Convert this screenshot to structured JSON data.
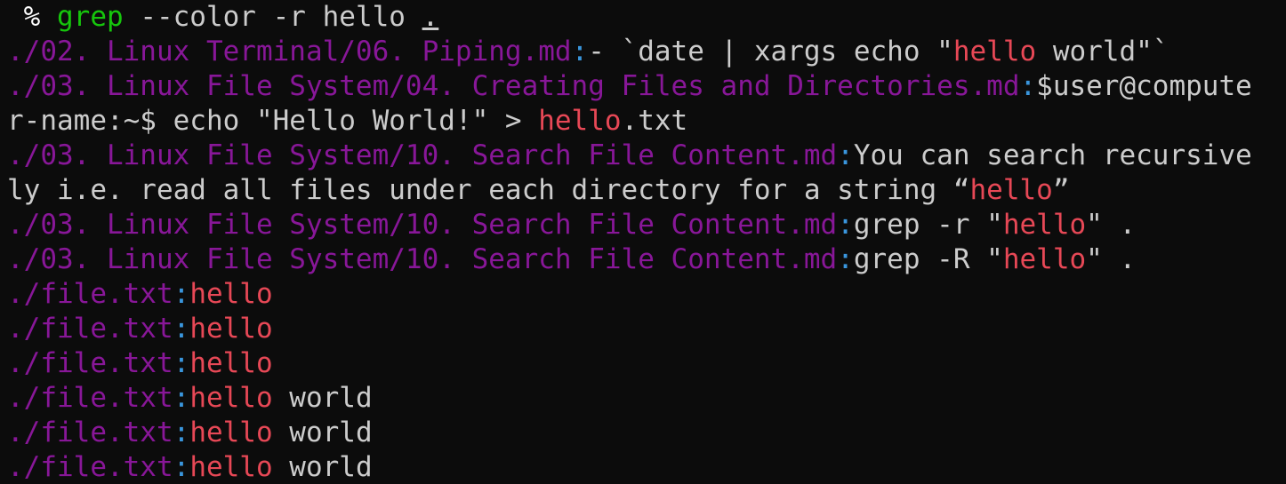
{
  "colors": {
    "background": "#0c0c0c",
    "default_text": "#cccccc",
    "prompt": "#ffffff",
    "command": "#16c60c",
    "file_path": "#881798",
    "separator": "#3a96dd",
    "match": "#e74856"
  },
  "lines": [
    {
      "type": "prompt",
      "segments": [
        {
          "text": " % ",
          "role": "prompt"
        },
        {
          "text": "grep",
          "role": "command"
        },
        {
          "text": " --color -r hello ",
          "role": "default"
        },
        {
          "text": ".",
          "role": "default",
          "underline": true
        }
      ]
    },
    {
      "type": "output",
      "segments": [
        {
          "text": "./02. Linux Terminal/06. Piping.md",
          "role": "file_path"
        },
        {
          "text": ":",
          "role": "separator"
        },
        {
          "text": "- `date | xargs echo \"",
          "role": "default"
        },
        {
          "text": "hello",
          "role": "match"
        },
        {
          "text": " world\"`",
          "role": "default"
        }
      ]
    },
    {
      "type": "output",
      "segments": [
        {
          "text": "./03. Linux File System/04. Creating Files and Directories.md",
          "role": "file_path"
        },
        {
          "text": ":",
          "role": "separator"
        },
        {
          "text": "$user@compute",
          "role": "default"
        }
      ]
    },
    {
      "type": "output-wrap",
      "segments": [
        {
          "text": "r-name:~$ echo \"Hello World!\" > ",
          "role": "default"
        },
        {
          "text": "hello",
          "role": "match"
        },
        {
          "text": ".txt",
          "role": "default"
        }
      ]
    },
    {
      "type": "output",
      "segments": [
        {
          "text": "./03. Linux File System/10. Search File Content.md",
          "role": "file_path"
        },
        {
          "text": ":",
          "role": "separator"
        },
        {
          "text": "You can search recursive",
          "role": "default"
        }
      ]
    },
    {
      "type": "output-wrap",
      "segments": [
        {
          "text": "ly i.e. read all files under each directory for a string “",
          "role": "default"
        },
        {
          "text": "hello",
          "role": "match"
        },
        {
          "text": "”",
          "role": "default"
        }
      ]
    },
    {
      "type": "output",
      "segments": [
        {
          "text": "./03. Linux File System/10. Search File Content.md",
          "role": "file_path"
        },
        {
          "text": ":",
          "role": "separator"
        },
        {
          "text": "grep -r \"",
          "role": "default"
        },
        {
          "text": "hello",
          "role": "match"
        },
        {
          "text": "\" .",
          "role": "default"
        }
      ]
    },
    {
      "type": "output",
      "segments": [
        {
          "text": "./03. Linux File System/10. Search File Content.md",
          "role": "file_path"
        },
        {
          "text": ":",
          "role": "separator"
        },
        {
          "text": "grep -R \"",
          "role": "default"
        },
        {
          "text": "hello",
          "role": "match"
        },
        {
          "text": "\" .",
          "role": "default"
        }
      ]
    },
    {
      "type": "output",
      "segments": [
        {
          "text": "./file.txt",
          "role": "file_path"
        },
        {
          "text": ":",
          "role": "separator"
        },
        {
          "text": "hello",
          "role": "match"
        }
      ]
    },
    {
      "type": "output",
      "segments": [
        {
          "text": "./file.txt",
          "role": "file_path"
        },
        {
          "text": ":",
          "role": "separator"
        },
        {
          "text": "hello",
          "role": "match"
        }
      ]
    },
    {
      "type": "output",
      "segments": [
        {
          "text": "./file.txt",
          "role": "file_path"
        },
        {
          "text": ":",
          "role": "separator"
        },
        {
          "text": "hello",
          "role": "match"
        }
      ]
    },
    {
      "type": "output",
      "segments": [
        {
          "text": "./file.txt",
          "role": "file_path"
        },
        {
          "text": ":",
          "role": "separator"
        },
        {
          "text": "hello",
          "role": "match"
        },
        {
          "text": " world",
          "role": "default"
        }
      ]
    },
    {
      "type": "output",
      "segments": [
        {
          "text": "./file.txt",
          "role": "file_path"
        },
        {
          "text": ":",
          "role": "separator"
        },
        {
          "text": "hello",
          "role": "match"
        },
        {
          "text": " world",
          "role": "default"
        }
      ]
    },
    {
      "type": "output",
      "segments": [
        {
          "text": "./file.txt",
          "role": "file_path"
        },
        {
          "text": ":",
          "role": "separator"
        },
        {
          "text": "hello",
          "role": "match"
        },
        {
          "text": " world",
          "role": "default"
        }
      ]
    }
  ]
}
